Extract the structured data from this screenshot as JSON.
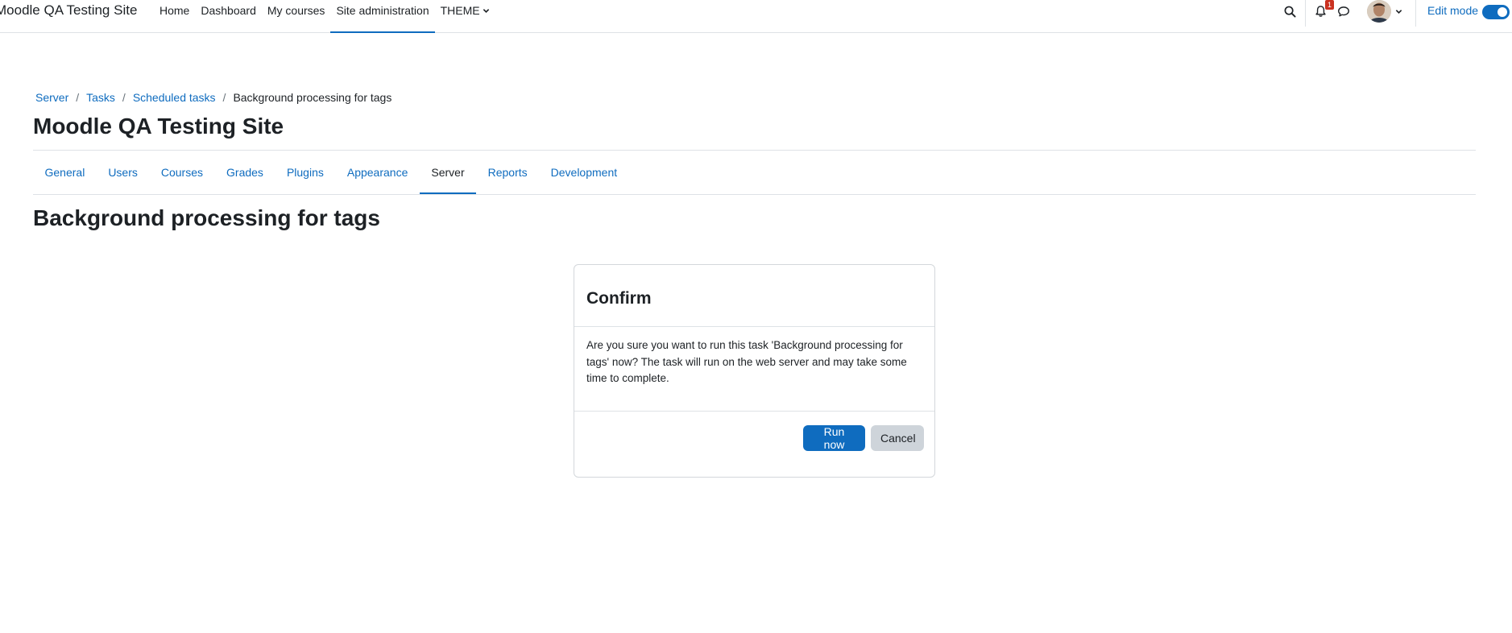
{
  "navbar": {
    "brand": "Moodle QA Testing Site",
    "items": [
      {
        "label": "Home"
      },
      {
        "label": "Dashboard"
      },
      {
        "label": "My courses"
      },
      {
        "label": "Site administration",
        "active": true
      },
      {
        "label": "THEME",
        "dropdown": true
      }
    ],
    "notifications_count": "1",
    "edit_mode_label": "Edit mode",
    "edit_mode_on": true
  },
  "breadcrumb": [
    {
      "label": "Server"
    },
    {
      "label": "Tasks"
    },
    {
      "label": "Scheduled tasks"
    },
    {
      "label": "Background processing for tags",
      "current": true
    }
  ],
  "page": {
    "site_title": "Moodle QA Testing Site",
    "heading": "Background processing for tags"
  },
  "secondary_nav": [
    {
      "label": "General"
    },
    {
      "label": "Users"
    },
    {
      "label": "Courses"
    },
    {
      "label": "Grades"
    },
    {
      "label": "Plugins"
    },
    {
      "label": "Appearance"
    },
    {
      "label": "Server",
      "active": true
    },
    {
      "label": "Reports"
    },
    {
      "label": "Development"
    }
  ],
  "confirm": {
    "title": "Confirm",
    "message": "Are you sure you want to run this task 'Background processing for tags' now? The task will run on the web server and may take some time to complete.",
    "primary_label": "Run now",
    "secondary_label": "Cancel"
  },
  "colors": {
    "accent": "#0f6cbf",
    "badge": "#ca3120",
    "secondary_button": "#ced4da"
  }
}
